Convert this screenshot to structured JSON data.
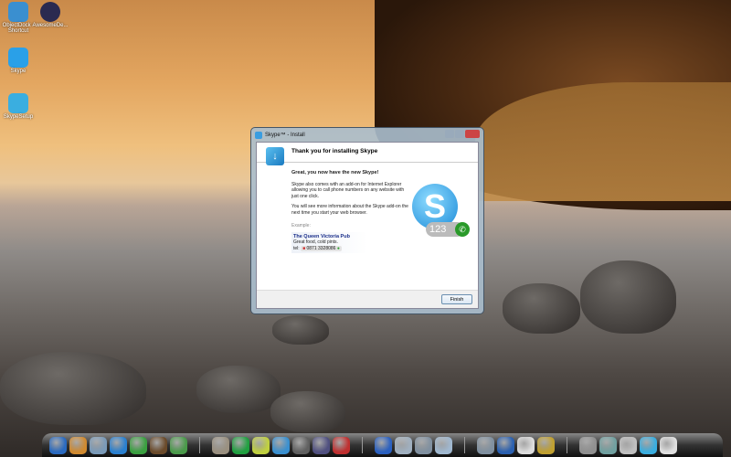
{
  "desktop": {
    "icons": [
      {
        "label": "ObjectDock - Shortcut",
        "icon": "objectdock-icon",
        "color": "#3a8fd0"
      },
      {
        "label": "AwesomeDe...",
        "icon": "disc-icon",
        "color": "#2a2a50"
      },
      {
        "label": "Skype",
        "icon": "skype-icon",
        "color": "#2aa0e8"
      },
      {
        "label": "SkypeSetup",
        "icon": "package-icon",
        "color": "#3aaee0"
      }
    ]
  },
  "dialog": {
    "title": "Skype™ - Install",
    "header": "Thank you for installing Skype",
    "subheading": "Great, you now have the new Skype!",
    "para1": "Skype also comes with an add-on for Internet Explorer allowing you to call phone numbers on any website with just one click.",
    "para2": "You will see more information about the Skype add-on the next time you start your web browser.",
    "example_label": "Example:",
    "example_name": "The Queen Victoria Pub",
    "example_desc": "Great food, cold pints.",
    "example_tel_label": "tel:",
    "example_phone": "0871 3328086",
    "badge_number": "123",
    "finish_label": "Finish"
  },
  "dock": {
    "groups": [
      [
        "#2a6ac0",
        "#d08a30",
        "#7a9ab8",
        "#2a80d0",
        "#3aa040",
        "#6a4a2a",
        "#4a9a4a"
      ],
      [
        "#9a9080",
        "#20a040",
        "#c0d040",
        "#3a90d0",
        "#606060",
        "#505080",
        "#c03030"
      ],
      [
        "#2a60c0",
        "#a0b0c0",
        "#8090a0",
        "#a0b8d0"
      ],
      [
        "#8090a0",
        "#2a60b0",
        "#ddd",
        "#c0a030"
      ],
      [
        "#909090",
        "#70a0a0",
        "#c0c0c0",
        "#3aaee0",
        "#e0e0e0"
      ]
    ]
  }
}
